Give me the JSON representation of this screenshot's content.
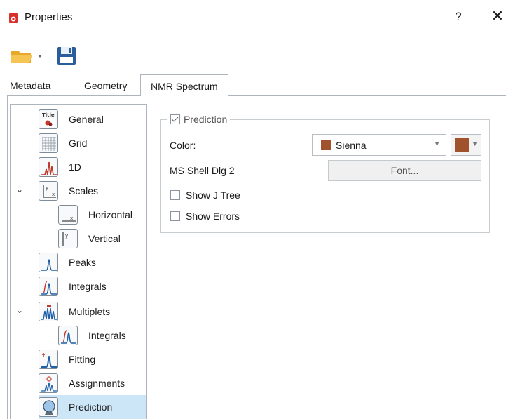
{
  "window": {
    "title": "Properties",
    "help_glyph": "?",
    "close_glyph": "✕"
  },
  "toolbar": {
    "open_icon": "folder-open-icon",
    "save_icon": "floppy-save-icon"
  },
  "tabs": [
    {
      "label": "Metadata",
      "active": false
    },
    {
      "label": "Geometry",
      "active": false
    },
    {
      "label": "NMR Spectrum",
      "active": true
    }
  ],
  "tree": {
    "items": [
      {
        "label": "General",
        "icon": "title-icon",
        "level": 0,
        "expandable": false,
        "selected": false
      },
      {
        "label": "Grid",
        "icon": "grid-icon",
        "level": 0,
        "expandable": false,
        "selected": false
      },
      {
        "label": "1D",
        "icon": "spectrum-1d-icon",
        "level": 0,
        "expandable": false,
        "selected": false
      },
      {
        "label": "Scales",
        "icon": "scales-icon",
        "level": 0,
        "expandable": true,
        "selected": false
      },
      {
        "label": "Horizontal",
        "icon": "horizontal-scale-icon",
        "level": 1,
        "expandable": false,
        "selected": false
      },
      {
        "label": "Vertical",
        "icon": "vertical-scale-icon",
        "level": 1,
        "expandable": false,
        "selected": false
      },
      {
        "label": "Peaks",
        "icon": "peaks-icon",
        "level": 0,
        "expandable": false,
        "selected": false
      },
      {
        "label": "Integrals",
        "icon": "integrals-icon",
        "level": 0,
        "expandable": false,
        "selected": false
      },
      {
        "label": "Multiplets",
        "icon": "multiplets-icon",
        "level": 0,
        "expandable": true,
        "selected": false
      },
      {
        "label": "Integrals",
        "icon": "integrals-icon",
        "level": 1,
        "expandable": false,
        "selected": false
      },
      {
        "label": "Fitting",
        "icon": "fitting-icon",
        "level": 0,
        "expandable": false,
        "selected": false
      },
      {
        "label": "Assignments",
        "icon": "assignments-icon",
        "level": 0,
        "expandable": false,
        "selected": false
      },
      {
        "label": "Prediction",
        "icon": "prediction-icon",
        "level": 0,
        "expandable": false,
        "selected": true
      }
    ]
  },
  "prediction": {
    "group_label": "Prediction",
    "enabled": true,
    "color_label": "Color:",
    "color_value": "Sienna",
    "color_hex": "#A0522D",
    "font_name": "MS Shell Dlg 2",
    "font_button": "Font...",
    "show_j_tree_label": "Show J Tree",
    "show_j_tree": false,
    "show_errors_label": "Show Errors",
    "show_errors": false
  },
  "colors": {
    "selection": "#cde6f7",
    "border": "#aeb4bb",
    "folder": "#f2b93b",
    "save": "#2b5d9a",
    "app_icon": "#d9302c"
  }
}
